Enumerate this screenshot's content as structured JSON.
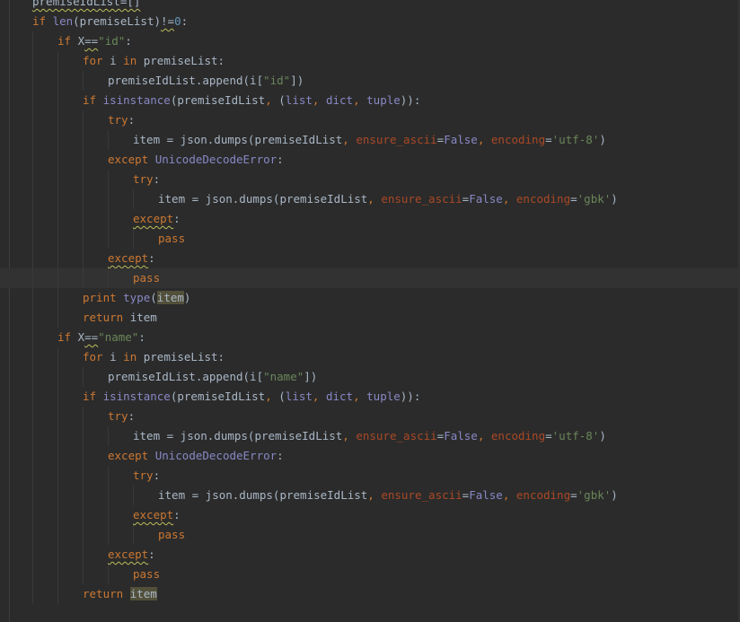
{
  "editor": {
    "language": "python",
    "current_line": 14,
    "theme": {
      "background": "#2b2b2b",
      "current_line_bg": "#323232",
      "keyword": "#cc7832",
      "builtin": "#8888c6",
      "string": "#6a8759",
      "number": "#6897bb",
      "kwarg": "#aa4926",
      "text": "#a9b7c6",
      "highlight": "#52503a"
    },
    "lines": [
      {
        "indent": 1,
        "tokens": [
          {
            "t": "premiseIdList=[]",
            "c": "id",
            "wavy": true
          }
        ]
      },
      {
        "indent": 1,
        "tokens": [
          {
            "t": "if ",
            "c": "kw"
          },
          {
            "t": "len",
            "c": "bi"
          },
          {
            "t": "(premiseList)",
            "c": "paren"
          },
          {
            "t": "!=",
            "c": "op",
            "wavy": true
          },
          {
            "t": "0",
            "c": "num"
          },
          {
            "t": ":",
            "c": "op"
          }
        ]
      },
      {
        "indent": 2,
        "tokens": [
          {
            "t": "if ",
            "c": "kw"
          },
          {
            "t": "X",
            "c": "id"
          },
          {
            "t": "==",
            "c": "op",
            "wavy": true
          },
          {
            "t": "\"id\"",
            "c": "str"
          },
          {
            "t": ":",
            "c": "op"
          }
        ]
      },
      {
        "indent": 3,
        "tokens": [
          {
            "t": "for ",
            "c": "kw"
          },
          {
            "t": "i ",
            "c": "id"
          },
          {
            "t": "in ",
            "c": "kw"
          },
          {
            "t": "premiseList:",
            "c": "id"
          }
        ]
      },
      {
        "indent": 4,
        "tokens": [
          {
            "t": "premiseIdList.append(i[",
            "c": "id"
          },
          {
            "t": "\"id\"",
            "c": "str"
          },
          {
            "t": "])",
            "c": "paren"
          }
        ]
      },
      {
        "indent": 3,
        "tokens": [
          {
            "t": "if ",
            "c": "kw"
          },
          {
            "t": "isinstance",
            "c": "bi"
          },
          {
            "t": "(premiseIdList",
            "c": "paren"
          },
          {
            "t": ", ",
            "c": "punct"
          },
          {
            "t": "(",
            "c": "paren"
          },
          {
            "t": "list",
            "c": "bi"
          },
          {
            "t": ", ",
            "c": "punct"
          },
          {
            "t": "dict",
            "c": "bi"
          },
          {
            "t": ", ",
            "c": "punct"
          },
          {
            "t": "tuple",
            "c": "bi"
          },
          {
            "t": ")):",
            "c": "paren"
          }
        ]
      },
      {
        "indent": 4,
        "tokens": [
          {
            "t": "try",
            "c": "kw"
          },
          {
            "t": ":",
            "c": "op"
          }
        ]
      },
      {
        "indent": 5,
        "tokens": [
          {
            "t": "item = json.dumps(premiseIdList",
            "c": "id"
          },
          {
            "t": ", ",
            "c": "punct"
          },
          {
            "t": "ensure_ascii",
            "c": "kwarg"
          },
          {
            "t": "=",
            "c": "op"
          },
          {
            "t": "False",
            "c": "bi"
          },
          {
            "t": ", ",
            "c": "punct"
          },
          {
            "t": "encoding",
            "c": "kwarg"
          },
          {
            "t": "=",
            "c": "op"
          },
          {
            "t": "'utf-8'",
            "c": "str"
          },
          {
            "t": ")",
            "c": "paren"
          }
        ]
      },
      {
        "indent": 4,
        "tokens": [
          {
            "t": "except ",
            "c": "kw"
          },
          {
            "t": "UnicodeDecodeError",
            "c": "bi"
          },
          {
            "t": ":",
            "c": "op"
          }
        ]
      },
      {
        "indent": 5,
        "tokens": [
          {
            "t": "try",
            "c": "kw"
          },
          {
            "t": ":",
            "c": "op"
          }
        ]
      },
      {
        "indent": 6,
        "tokens": [
          {
            "t": "item = json.dumps(premiseIdList",
            "c": "id"
          },
          {
            "t": ", ",
            "c": "punct"
          },
          {
            "t": "ensure_ascii",
            "c": "kwarg"
          },
          {
            "t": "=",
            "c": "op"
          },
          {
            "t": "False",
            "c": "bi"
          },
          {
            "t": ", ",
            "c": "punct"
          },
          {
            "t": "encoding",
            "c": "kwarg"
          },
          {
            "t": "=",
            "c": "op"
          },
          {
            "t": "'gbk'",
            "c": "str"
          },
          {
            "t": ")",
            "c": "paren"
          }
        ]
      },
      {
        "indent": 5,
        "tokens": [
          {
            "t": "except",
            "c": "kw",
            "wavy": true
          },
          {
            "t": ":",
            "c": "op"
          }
        ]
      },
      {
        "indent": 6,
        "tokens": [
          {
            "t": "pass",
            "c": "kw"
          }
        ]
      },
      {
        "indent": 4,
        "tokens": [
          {
            "t": "except",
            "c": "kw",
            "wavy": true
          },
          {
            "t": ":",
            "c": "op"
          }
        ]
      },
      {
        "indent": 5,
        "tokens": [
          {
            "t": "pass",
            "c": "kw"
          }
        ]
      },
      {
        "indent": 3,
        "tokens": [
          {
            "t": "print ",
            "c": "kw"
          },
          {
            "t": "type",
            "c": "bi"
          },
          {
            "t": "(",
            "c": "paren"
          },
          {
            "t": "item",
            "c": "id",
            "hl": true
          },
          {
            "t": ")",
            "c": "paren"
          }
        ]
      },
      {
        "indent": 3,
        "tokens": [
          {
            "t": "return ",
            "c": "kw"
          },
          {
            "t": "item",
            "c": "id"
          }
        ]
      },
      {
        "indent": 2,
        "tokens": [
          {
            "t": "if ",
            "c": "kw"
          },
          {
            "t": "X",
            "c": "id"
          },
          {
            "t": "==",
            "c": "op",
            "wavy": true
          },
          {
            "t": "\"name\"",
            "c": "str"
          },
          {
            "t": ":",
            "c": "op"
          }
        ]
      },
      {
        "indent": 3,
        "tokens": [
          {
            "t": "for ",
            "c": "kw"
          },
          {
            "t": "i ",
            "c": "id"
          },
          {
            "t": "in ",
            "c": "kw"
          },
          {
            "t": "premiseList:",
            "c": "id"
          }
        ]
      },
      {
        "indent": 4,
        "tokens": [
          {
            "t": "premiseIdList.append(i[",
            "c": "id"
          },
          {
            "t": "\"name\"",
            "c": "str"
          },
          {
            "t": "])",
            "c": "paren"
          }
        ]
      },
      {
        "indent": 3,
        "tokens": [
          {
            "t": "if ",
            "c": "kw"
          },
          {
            "t": "isinstance",
            "c": "bi"
          },
          {
            "t": "(premiseIdList",
            "c": "paren"
          },
          {
            "t": ", ",
            "c": "punct"
          },
          {
            "t": "(",
            "c": "paren"
          },
          {
            "t": "list",
            "c": "bi"
          },
          {
            "t": ", ",
            "c": "punct"
          },
          {
            "t": "dict",
            "c": "bi"
          },
          {
            "t": ", ",
            "c": "punct"
          },
          {
            "t": "tuple",
            "c": "bi"
          },
          {
            "t": ")):",
            "c": "paren"
          }
        ]
      },
      {
        "indent": 4,
        "tokens": [
          {
            "t": "try",
            "c": "kw"
          },
          {
            "t": ":",
            "c": "op"
          }
        ]
      },
      {
        "indent": 5,
        "tokens": [
          {
            "t": "item = json.dumps(premiseIdList",
            "c": "id"
          },
          {
            "t": ", ",
            "c": "punct"
          },
          {
            "t": "ensure_ascii",
            "c": "kwarg"
          },
          {
            "t": "=",
            "c": "op"
          },
          {
            "t": "False",
            "c": "bi"
          },
          {
            "t": ", ",
            "c": "punct"
          },
          {
            "t": "encoding",
            "c": "kwarg"
          },
          {
            "t": "=",
            "c": "op"
          },
          {
            "t": "'utf-8'",
            "c": "str"
          },
          {
            "t": ")",
            "c": "paren"
          }
        ]
      },
      {
        "indent": 4,
        "tokens": [
          {
            "t": "except ",
            "c": "kw"
          },
          {
            "t": "UnicodeDecodeError",
            "c": "bi"
          },
          {
            "t": ":",
            "c": "op"
          }
        ]
      },
      {
        "indent": 5,
        "tokens": [
          {
            "t": "try",
            "c": "kw"
          },
          {
            "t": ":",
            "c": "op"
          }
        ]
      },
      {
        "indent": 6,
        "tokens": [
          {
            "t": "item = json.dumps(premiseIdList",
            "c": "id"
          },
          {
            "t": ", ",
            "c": "punct"
          },
          {
            "t": "ensure_ascii",
            "c": "kwarg"
          },
          {
            "t": "=",
            "c": "op"
          },
          {
            "t": "False",
            "c": "bi"
          },
          {
            "t": ", ",
            "c": "punct"
          },
          {
            "t": "encoding",
            "c": "kwarg"
          },
          {
            "t": "=",
            "c": "op"
          },
          {
            "t": "'gbk'",
            "c": "str"
          },
          {
            "t": ")",
            "c": "paren"
          }
        ]
      },
      {
        "indent": 5,
        "tokens": [
          {
            "t": "except",
            "c": "kw",
            "wavy": true
          },
          {
            "t": ":",
            "c": "op"
          }
        ]
      },
      {
        "indent": 6,
        "tokens": [
          {
            "t": "pass",
            "c": "kw"
          }
        ]
      },
      {
        "indent": 4,
        "tokens": [
          {
            "t": "except",
            "c": "kw",
            "wavy": true
          },
          {
            "t": ":",
            "c": "op"
          }
        ]
      },
      {
        "indent": 5,
        "tokens": [
          {
            "t": "pass",
            "c": "kw"
          }
        ]
      },
      {
        "indent": 3,
        "tokens": [
          {
            "t": "return ",
            "c": "kw"
          },
          {
            "t": "item",
            "c": "id",
            "hl": true
          }
        ]
      }
    ]
  }
}
